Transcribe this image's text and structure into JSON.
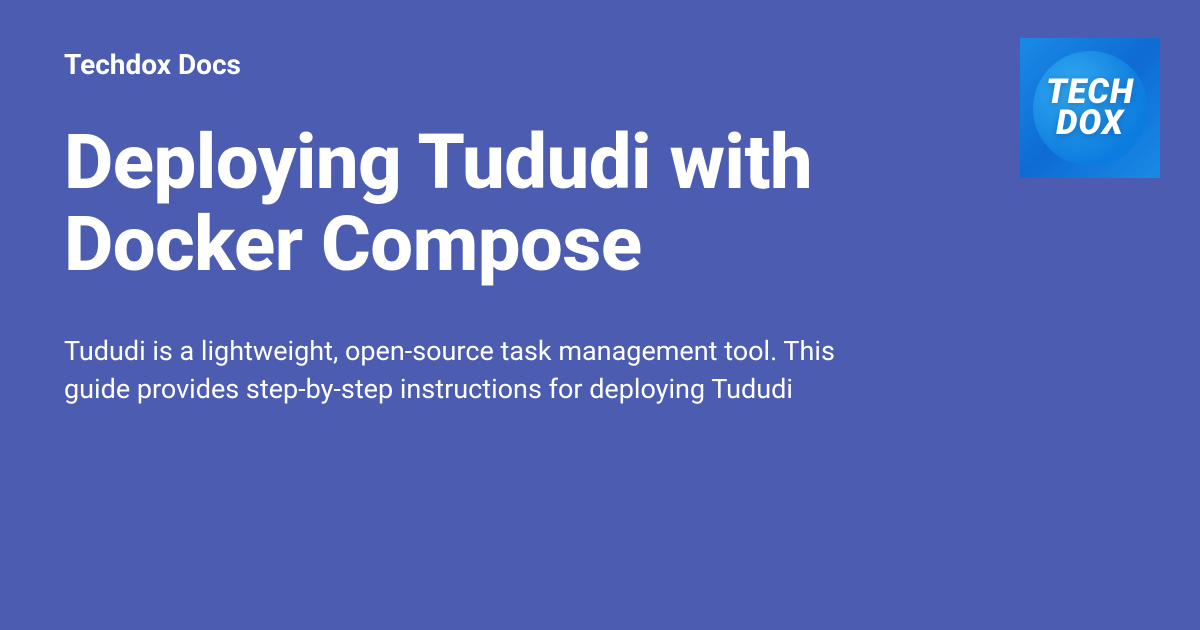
{
  "site_name": "Techdox Docs",
  "title": "Deploying Tududi with Docker Compose",
  "description": "Tududi is a lightweight, open-source task management tool. This guide provides step-by-step instructions for deploying Tududi",
  "logo": {
    "line1": "TECH",
    "line2": "DOX"
  }
}
